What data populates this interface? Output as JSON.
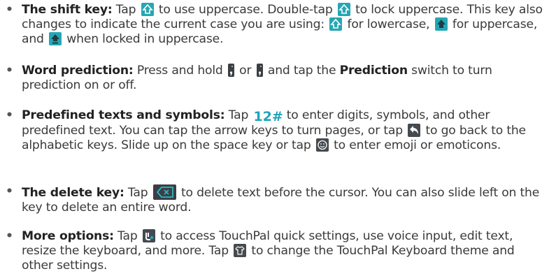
{
  "bullet": "•",
  "items": [
    {
      "title": "The shift key:",
      "p1": " Tap ",
      "p2": " to use uppercase. Double-tap ",
      "p3": " to lock uppercase. This key also changes to indicate the current case you are using: ",
      "p4": " for lowercase, ",
      "p5": " for uppercase, and ",
      "p6": " when locked in uppercase."
    },
    {
      "title": "Word prediction:",
      "p1": " Press and hold ",
      "p2": " or ",
      "p3": " and tap the ",
      "bold2": "Prediction",
      "p4": " switch to turn prediction on or off."
    },
    {
      "title": "Predefined texts and symbols:",
      "p1": " Tap ",
      "symbol_key": "12#",
      "p2": " to enter digits, symbols, and other predefined text. You can tap the arrow keys to turn pages, or tap ",
      "p3": " to go back to the alphabetic keys. Slide up on the space key or tap ",
      "p4": " to enter emoji or emoticons."
    },
    {
      "title": "The delete key:",
      "p1": " Tap ",
      "p2": " to delete text before the cursor. You can also slide left on the key to delete an entire word."
    },
    {
      "title": "More options:",
      "p1": " Tap ",
      "p2": " to access TouchPal quick settings, use voice input, edit text, resize the keyboard, and more. Tap ",
      "p3": " to change the TouchPal Keyboard theme and other settings."
    }
  ],
  "icons": {
    "shift": "shift-outline-icon",
    "shift_lower": "shift-lowercase-icon",
    "shift_upper": "shift-uppercase-icon",
    "shift_locked": "shift-locked-icon",
    "prediction_key": "comma-prediction-key-icon",
    "back": "back-arrow-icon",
    "emoji": "emoji-smiley-icon",
    "delete": "delete-key-icon",
    "touchpal": "touchpal-logo-icon",
    "theme": "theme-shirt-icon"
  },
  "colors": {
    "teal": "#25a7b3",
    "key_dark": "#3b3f44",
    "text": "#3a3a3a"
  }
}
